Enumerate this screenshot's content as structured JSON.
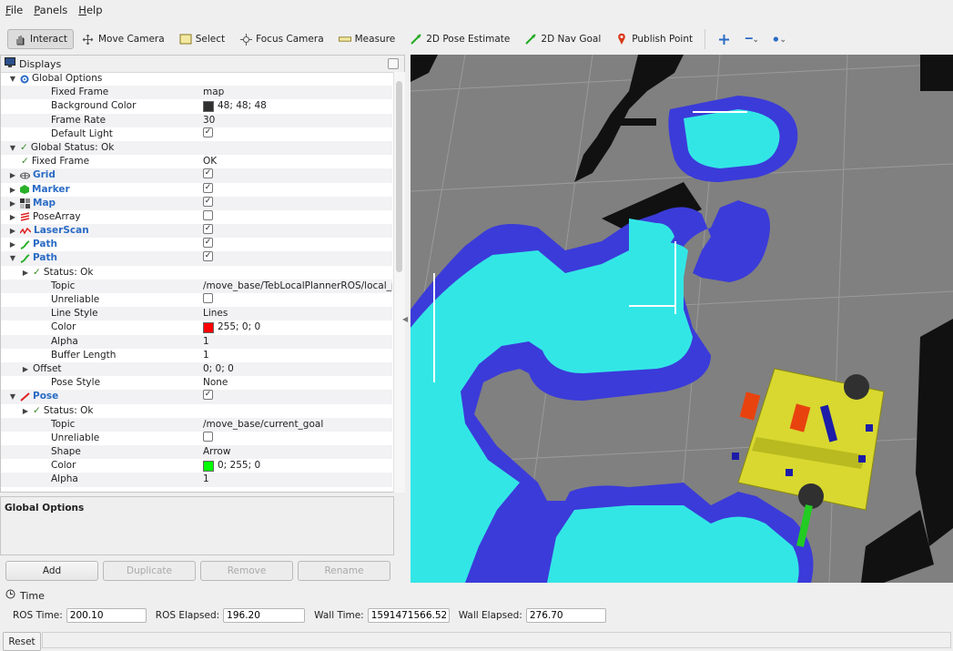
{
  "menu": [
    "File",
    "Panels",
    "Help"
  ],
  "toolbar": {
    "tools": [
      {
        "label": "Interact",
        "icon": "hand-icon",
        "active": true
      },
      {
        "label": "Move Camera",
        "icon": "move-camera-icon"
      },
      {
        "label": "Select",
        "icon": "select-icon"
      },
      {
        "label": "Focus Camera",
        "icon": "focus-camera-icon"
      },
      {
        "label": "Measure",
        "icon": "ruler-icon"
      },
      {
        "label": "2D Pose Estimate",
        "icon": "pose-estimate-icon"
      },
      {
        "label": "2D Nav Goal",
        "icon": "nav-goal-icon"
      },
      {
        "label": "Publish Point",
        "icon": "pin-icon"
      }
    ]
  },
  "displays": {
    "title": "Displays",
    "rows": [
      {
        "label": "Global Options",
        "arrow": "▼",
        "icon": "gear-icon",
        "depth": 0,
        "value": ""
      },
      {
        "label": "Fixed Frame",
        "depth": 2,
        "value": "map"
      },
      {
        "label": "Background Color",
        "depth": 2,
        "value": "48; 48; 48",
        "swatch": "#303030"
      },
      {
        "label": "Frame Rate",
        "depth": 2,
        "value": "30"
      },
      {
        "label": "Default Light",
        "depth": 2,
        "check": true
      },
      {
        "label": "Global Status: Ok",
        "arrow": "▼",
        "tick": true,
        "depth": 0,
        "value": ""
      },
      {
        "label": "Fixed Frame",
        "tick": true,
        "depth": 1,
        "value": "OK"
      },
      {
        "label": "Grid",
        "arrow": "▶",
        "icon": "grid-icon",
        "blue": true,
        "depth": 0,
        "check": true
      },
      {
        "label": "Marker",
        "arrow": "▶",
        "icon": "marker-icon",
        "blue": true,
        "depth": 0,
        "check": true
      },
      {
        "label": "Map",
        "arrow": "▶",
        "icon": "map-icon",
        "blue": true,
        "depth": 0,
        "check": true
      },
      {
        "label": "PoseArray",
        "arrow": "▶",
        "icon": "pose-array-icon",
        "depth": 0,
        "check": false
      },
      {
        "label": "LaserScan",
        "arrow": "▶",
        "icon": "laser-icon",
        "blue": true,
        "depth": 0,
        "check": true
      },
      {
        "label": "Path",
        "arrow": "▶",
        "icon": "path-icon",
        "blue": true,
        "depth": 0,
        "check": true
      },
      {
        "label": "Path",
        "arrow": "▼",
        "icon": "path-icon",
        "blue": true,
        "depth": 0,
        "check": true
      },
      {
        "label": "Status: Ok",
        "arrow": "▶",
        "tick": true,
        "depth": 1,
        "value": ""
      },
      {
        "label": "Topic",
        "depth": 2,
        "value": "/move_base/TebLocalPlannerROS/local_plan"
      },
      {
        "label": "Unreliable",
        "depth": 2,
        "check": false
      },
      {
        "label": "Line Style",
        "depth": 2,
        "value": "Lines"
      },
      {
        "label": "Color",
        "depth": 2,
        "value": "255; 0; 0",
        "swatch": "#ff0000"
      },
      {
        "label": "Alpha",
        "depth": 2,
        "value": "1"
      },
      {
        "label": "Buffer Length",
        "depth": 2,
        "value": "1"
      },
      {
        "label": "Offset",
        "arrow": "▶",
        "depth": 1,
        "value": "0; 0; 0"
      },
      {
        "label": "Pose Style",
        "depth": 2,
        "value": "None"
      },
      {
        "label": "Pose",
        "arrow": "▼",
        "icon": "pose-icon",
        "blue": true,
        "depth": 0,
        "check": true
      },
      {
        "label": "Status: Ok",
        "arrow": "▶",
        "tick": true,
        "depth": 1,
        "value": ""
      },
      {
        "label": "Topic",
        "depth": 2,
        "value": "/move_base/current_goal"
      },
      {
        "label": "Unreliable",
        "depth": 2,
        "check": false
      },
      {
        "label": "Shape",
        "depth": 2,
        "value": "Arrow"
      },
      {
        "label": "Color",
        "depth": 2,
        "value": "0; 255; 0",
        "swatch": "#00ff00"
      },
      {
        "label": "Alpha",
        "depth": 2,
        "value": "1"
      }
    ]
  },
  "description": {
    "title": "Global Options"
  },
  "buttons": [
    {
      "label": "Add",
      "enabled": true
    },
    {
      "label": "Duplicate",
      "enabled": false
    },
    {
      "label": "Remove",
      "enabled": false
    },
    {
      "label": "Rename",
      "enabled": false
    }
  ],
  "time": {
    "title": "Time",
    "ros_time_label": "ROS Time:",
    "ros_time": "200.10",
    "ros_elapsed_label": "ROS Elapsed:",
    "ros_elapsed": "196.20",
    "wall_time_label": "Wall Time:",
    "wall_time": "1591471566.52",
    "wall_elapsed_label": "Wall Elapsed:",
    "wall_elapsed": "276.70"
  },
  "reset_label": "Reset",
  "colors": {
    "costmap_outer": "#3b3bd9",
    "costmap_inner": "#33e6e6",
    "robot_body": "#d8d830",
    "goal_arrow": "#22cc22",
    "viewport_bg": "#808080"
  }
}
